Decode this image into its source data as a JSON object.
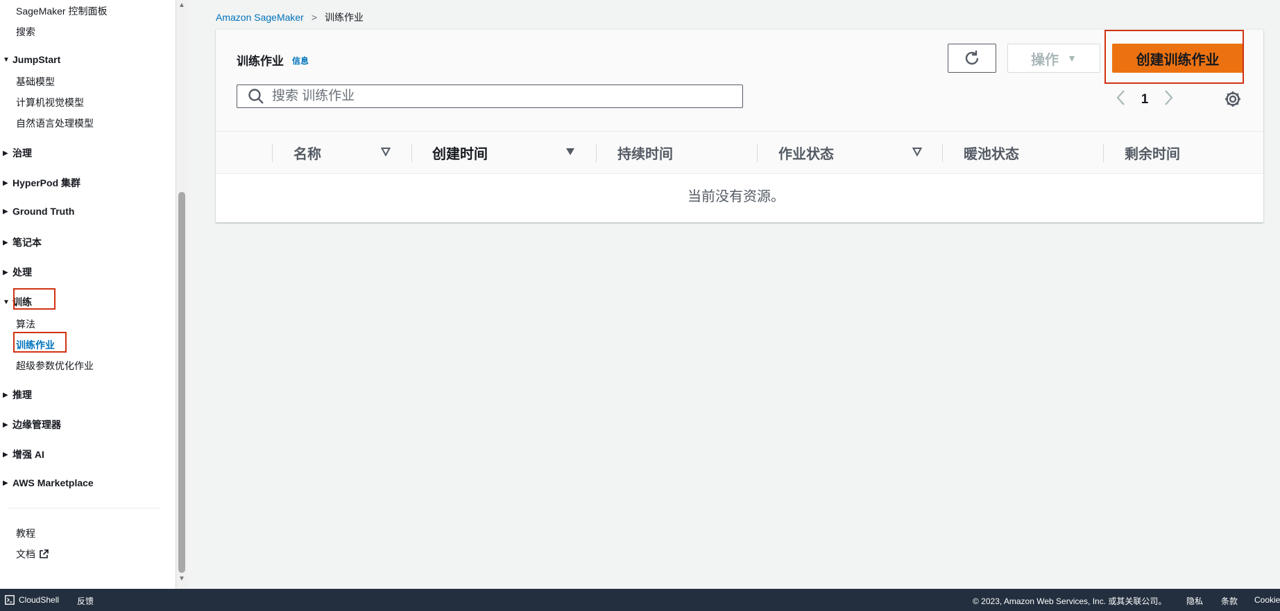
{
  "sidebar": {
    "dashboard": "SageMaker 控制面板",
    "search": "搜索",
    "jumpstart": {
      "label": "JumpStart",
      "items": [
        "基础模型",
        "计算机视觉模型",
        "自然语言处理模型"
      ]
    },
    "governance": "治理",
    "hyperpod": "HyperPod 集群",
    "ground_truth": "Ground Truth",
    "notebooks": "笔记本",
    "processing": "处理",
    "training": {
      "label": "训练",
      "items": [
        "算法",
        "训练作业",
        "超级参数优化作业"
      ]
    },
    "inference": "推理",
    "edge": "边缘管理器",
    "augmented_ai": "增强 AI",
    "marketplace": "AWS Marketplace",
    "tutorials": "教程",
    "docs": "文档"
  },
  "breadcrumb": {
    "root": "Amazon SageMaker",
    "current": "训练作业"
  },
  "panel": {
    "title": "训练作业",
    "info": "信息",
    "actions_label": "操作",
    "create_label": "创建训练作业",
    "search_placeholder": "搜索 训练作业",
    "page": "1",
    "columns": [
      "名称",
      "创建时间",
      "持续时间",
      "作业状态",
      "暖池状态",
      "剩余时间"
    ],
    "empty_message": "当前没有资源。"
  },
  "footer": {
    "cloudshell": "CloudShell",
    "feedback": "反馈",
    "copyright": "© 2023, Amazon Web Services, Inc. 或其关联公司。",
    "privacy": "隐私",
    "terms": "条款",
    "cookies": "Cookie"
  },
  "colors": {
    "primary_button": "#ec7211",
    "link": "#0073bb",
    "footer_bg": "#232f3e",
    "highlight": "#d13212"
  }
}
